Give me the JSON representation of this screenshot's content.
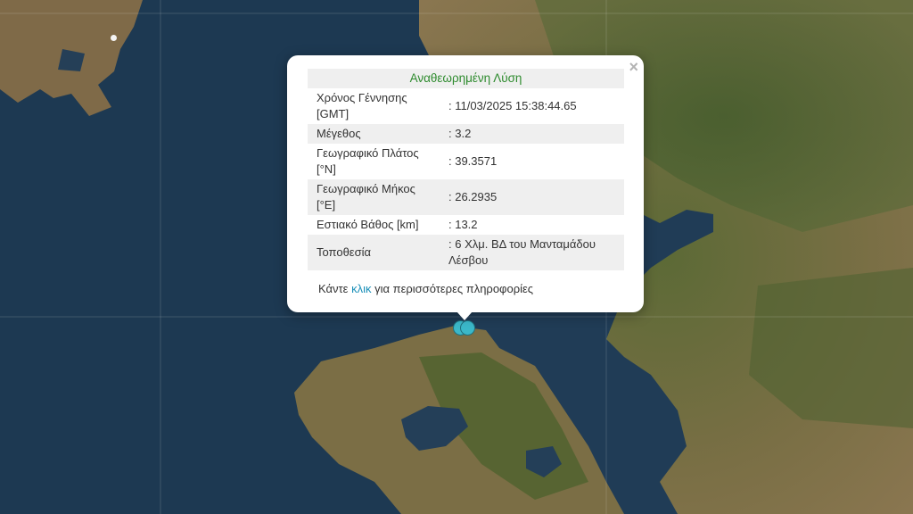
{
  "popup": {
    "title": "Αναθεωρημένη Λύση",
    "rows": [
      {
        "label": "Χρόνος Γέννησης [GMT]",
        "value": ": 11/03/2025 15:38:44.65"
      },
      {
        "label": "Μέγεθος",
        "value": ": 3.2"
      },
      {
        "label": "Γεωγραφικό Πλάτος [°N]",
        "value": ": 39.3571"
      },
      {
        "label": "Γεωγραφικό Μήκος [°E]",
        "value": ": 26.2935"
      },
      {
        "label": "Εστιακό Βάθος [km]",
        "value": ": 13.2"
      },
      {
        "label": "Τοποθεσία",
        "value": ": 6 Χλμ. ΒΔ του Μανταμάδου Λέσβου"
      }
    ],
    "footer_prefix": "Κάντε ",
    "footer_link": "κλικ",
    "footer_suffix": " για περισσότερες πληροφορίες",
    "close_symbol": "×"
  },
  "colors": {
    "sea": "#1f3a52",
    "land": "#6b6a3e",
    "title_green": "#2e8b2e",
    "link": "#1a8fb8",
    "marker": "#3bb8c9"
  },
  "icons": [
    "close-icon",
    "earthquake-marker-icon"
  ]
}
